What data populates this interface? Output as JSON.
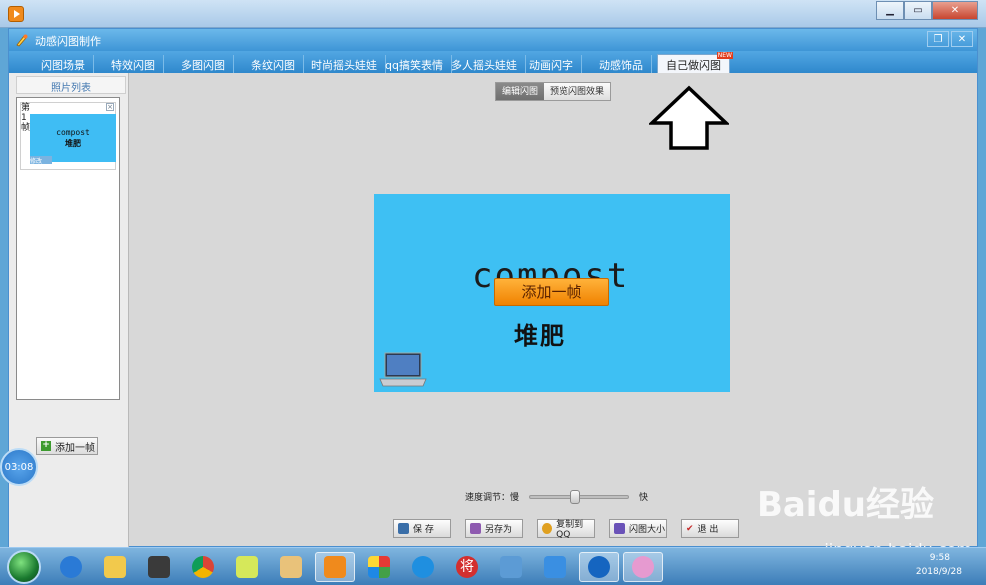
{
  "app": {
    "title": "动感闪图制作",
    "tabs": [
      {
        "label": "闪图场景",
        "active": false
      },
      {
        "label": "特效闪图",
        "active": false
      },
      {
        "label": "多图闪图",
        "active": false
      },
      {
        "label": "条纹闪图",
        "active": false
      },
      {
        "label": "时尚摇头娃娃",
        "active": false
      },
      {
        "label": "qq搞笑表情",
        "active": false
      },
      {
        "label": "多人摇头娃娃",
        "active": false
      },
      {
        "label": "动画闪字",
        "active": false
      },
      {
        "label": "动感饰品",
        "active": false
      },
      {
        "label": "自己做闪图",
        "active": true
      }
    ],
    "new_badge": "NEW"
  },
  "left_panel": {
    "header": "照片列表",
    "frame": {
      "label": "第1帧",
      "thumb_en": "compost",
      "thumb_cn": "堆肥",
      "tag": "修改"
    },
    "add_frame": "添加一帧"
  },
  "mode": {
    "edit": "编辑闪图",
    "preview": "预览闪图效果"
  },
  "canvas": {
    "text_en": "compost",
    "text_cn": "堆肥",
    "add_frame": "添加一帧",
    "background": "#3ec0f3"
  },
  "speed": {
    "label": "速度调节：慢",
    "fast": "快",
    "value": 0.45
  },
  "buttons": {
    "save": "保  存",
    "save_as": "另存为",
    "copy_qq": "复制到QQ",
    "size": "闪图大小",
    "exit": "退  出"
  },
  "timer": "03:08",
  "taskbar": {
    "time": "9:58",
    "date": "2018/9/28"
  },
  "watermark": {
    "main": "Baidu经验",
    "sub": "jingyan.baidu.com"
  },
  "colors": {
    "accent": "#3e95d6",
    "canvas": "#3ec0f3",
    "add_button": "#f08200"
  }
}
